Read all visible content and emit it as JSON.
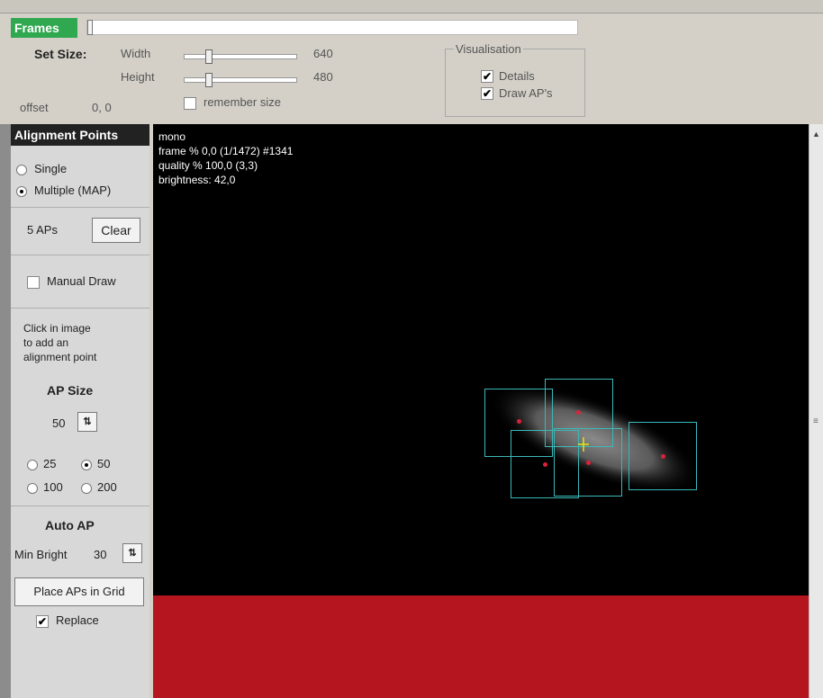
{
  "frames": {
    "tab_label": "Frames",
    "slider_position_fraction": 0.0
  },
  "set_size": {
    "label": "Set Size:",
    "width_label": "Width",
    "width_value": "640",
    "height_label": "Height",
    "height_value": "480",
    "remember_label": "remember size",
    "remember_checked": false
  },
  "offset": {
    "label": "offset",
    "value": "0, 0"
  },
  "visualisation": {
    "title": "Visualisation",
    "details_label": "Details",
    "details_checked": true,
    "draw_aps_label": "Draw AP's",
    "draw_aps_checked": true
  },
  "alignment": {
    "header": "Alignment Points",
    "mode_single": "Single",
    "mode_multiple": "Multiple (MAP)",
    "selected_mode": "Multiple (MAP)",
    "ap_count": "5 APs",
    "clear_label": "Clear",
    "manual_draw_label": "Manual Draw",
    "manual_draw_checked": false,
    "help_line1": "Click in image",
    "help_line2": "to add an",
    "help_line3": "alignment point",
    "ap_size_title": "AP Size",
    "ap_size_value": "50",
    "size_options": [
      "25",
      "50",
      "100",
      "200"
    ],
    "selected_size": "50",
    "auto_ap_title": "Auto AP",
    "min_bright_label": "Min Bright",
    "min_bright_value": "30",
    "place_grid_label": "Place APs in Grid",
    "replace_label": "Replace",
    "replace_checked": true
  },
  "viewer": {
    "line1": "mono",
    "line2": "frame % 0,0 (1/1472) #1341",
    "line3": "quality % 100,0  (3,3)",
    "line4": "brightness: 42,0"
  },
  "colors": {
    "accent_green": "#2fa84f",
    "ap_box": "#3bb8b8",
    "ap_dot": "#e0203a",
    "red_area": "#b4151f"
  }
}
